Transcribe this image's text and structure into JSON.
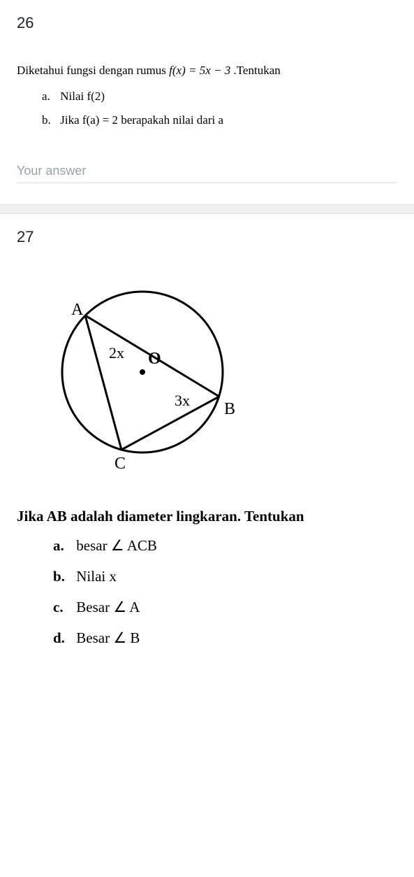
{
  "q26": {
    "number": "26",
    "main_text_pre": "Diketahui fungsi dengan rumus ",
    "main_text_formula": "f(x) = 5x − 3",
    "main_text_post": " .Tentukan",
    "items": [
      {
        "marker": "a.",
        "text": "Nilai f(2)"
      },
      {
        "marker": "b.",
        "text": "Jika f(a) = 2 berapakah nilai dari a"
      }
    ],
    "answer_placeholder": "Your answer"
  },
  "q27": {
    "number": "27",
    "diagram": {
      "labels": {
        "A": "A",
        "B": "B",
        "C": "C",
        "O": "O",
        "angle_A": "2x",
        "angle_B": "3x"
      }
    },
    "main_text": "Jika AB adalah diameter lingkaran. Tentukan",
    "items": [
      {
        "marker": "a.",
        "text": "besar ∠ ACB"
      },
      {
        "marker": "b.",
        "text": "Nilai x"
      },
      {
        "marker": "c.",
        "text": "Besar ∠ A"
      },
      {
        "marker": "d.",
        "text": "Besar ∠ B"
      }
    ]
  }
}
